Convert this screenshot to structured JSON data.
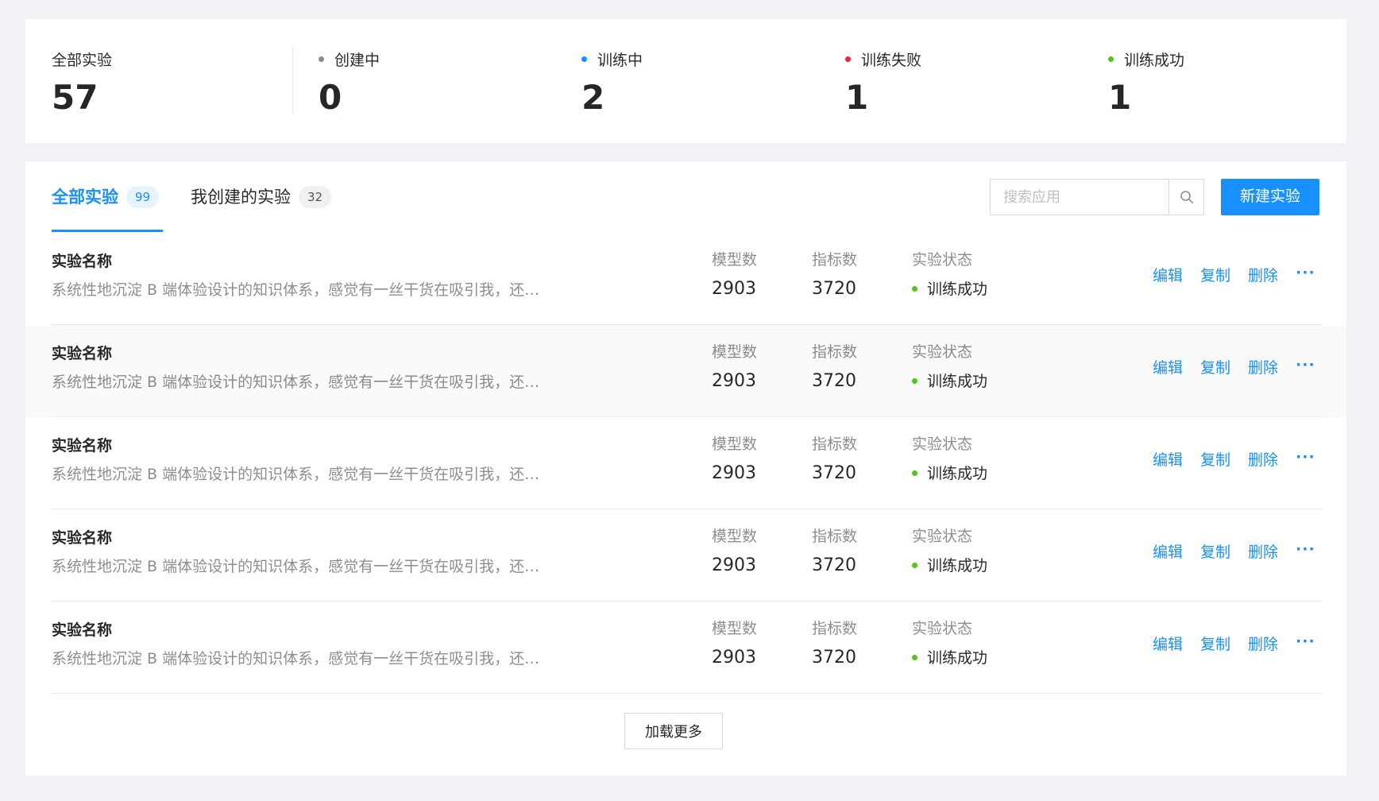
{
  "stats": [
    {
      "label": "全部实验",
      "value": "57",
      "dot_color": null
    },
    {
      "label": "创建中",
      "value": "0",
      "dot_color": "#8c8c8c"
    },
    {
      "label": "训练中",
      "value": "2",
      "dot_color": "#1890ff"
    },
    {
      "label": "训练失败",
      "value": "1",
      "dot_color": "#f5222d"
    },
    {
      "label": "训练成功",
      "value": "1",
      "dot_color": "#52c41a"
    }
  ],
  "tabs": [
    {
      "label": "全部实验",
      "count": "99",
      "active": true
    },
    {
      "label": "我创建的实验",
      "count": "32",
      "active": false
    }
  ],
  "search": {
    "placeholder": "搜索应用",
    "icon": "search-icon"
  },
  "new_button": {
    "label": "新建实验"
  },
  "columns": {
    "models": "模型数",
    "metrics": "指标数",
    "status": "实验状态"
  },
  "rows": [
    {
      "title": "实验名称",
      "desc": "系统性地沉淀 B 端体验设计的知识体系，感觉有一丝干货在吸引我，还…",
      "models": "2903",
      "metrics": "3720",
      "status": "训练成功",
      "hover": false
    },
    {
      "title": "实验名称",
      "desc": "系统性地沉淀 B 端体验设计的知识体系，感觉有一丝干货在吸引我，还…",
      "models": "2903",
      "metrics": "3720",
      "status": "训练成功",
      "hover": true
    },
    {
      "title": "实验名称",
      "desc": "系统性地沉淀 B 端体验设计的知识体系，感觉有一丝干货在吸引我，还…",
      "models": "2903",
      "metrics": "3720",
      "status": "训练成功",
      "hover": false
    },
    {
      "title": "实验名称",
      "desc": "系统性地沉淀 B 端体验设计的知识体系，感觉有一丝干货在吸引我，还…",
      "models": "2903",
      "metrics": "3720",
      "status": "训练成功",
      "hover": false
    },
    {
      "title": "实验名称",
      "desc": "系统性地沉淀 B 端体验设计的知识体系，感觉有一丝干货在吸引我，还…",
      "models": "2903",
      "metrics": "3720",
      "status": "训练成功",
      "hover": false
    }
  ],
  "actions": {
    "edit": "编辑",
    "copy": "复制",
    "delete": "删除",
    "more": "···"
  },
  "load_more": {
    "label": "加载更多"
  },
  "colors": {
    "primary": "#1890ff",
    "success": "#52c41a",
    "error": "#f5222d",
    "default": "#8c8c8c"
  }
}
